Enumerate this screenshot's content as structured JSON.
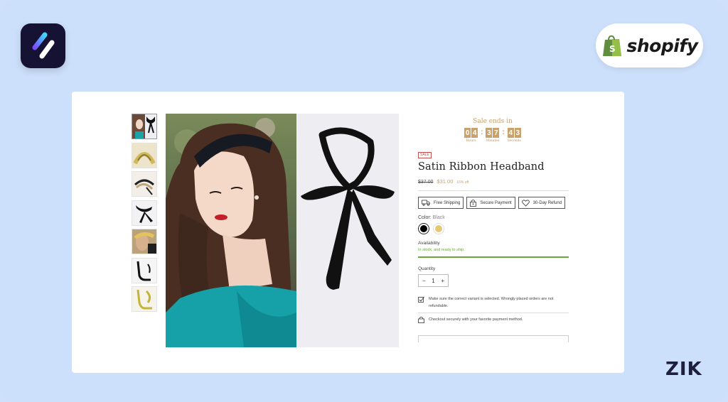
{
  "brand": {
    "shopify_wordmark": "shopify",
    "corner_mark": "ZIK"
  },
  "product": {
    "sale_ends_label": "Sale ends in",
    "countdown": {
      "hours": [
        "0",
        "4"
      ],
      "minutes": [
        "3",
        "7"
      ],
      "seconds": [
        "4",
        "3"
      ],
      "hours_label": "Hours",
      "minutes_label": "Minutes",
      "seconds_label": "Seconds"
    },
    "sale_badge": "SALE",
    "title": "Satin Ribbon Headband",
    "old_price": "$37.00",
    "new_price": "$31.00",
    "discount": "16% off",
    "badges": [
      {
        "label": "Free Shipping",
        "icon": "truck-icon"
      },
      {
        "label": "Secure Payment",
        "icon": "lock-icon"
      },
      {
        "label": "30-Day Refund",
        "icon": "heart-icon"
      }
    ],
    "color_label": "Color:",
    "color_value": "Black",
    "colors": [
      {
        "name": "Black",
        "hex": "#000000",
        "selected": true
      },
      {
        "name": "Gold",
        "hex": "#e6c772",
        "selected": false
      }
    ],
    "availability_label": "Availability",
    "stock_text": "In stock, and ready to ship.",
    "quantity_label": "Quantity",
    "quantity": {
      "minus": "−",
      "value": "1",
      "plus": "+"
    },
    "notice_variant": "Make sure the correct variant is selected. Wrongly placed orders are not refundable.",
    "notice_checkout": "Checkout securely with your favorite payment method."
  },
  "colors": {
    "background": "#cde0fb",
    "accent_gold": "#c9a16b",
    "stock_green": "#6aa63c",
    "sale_red": "#c1504a"
  }
}
